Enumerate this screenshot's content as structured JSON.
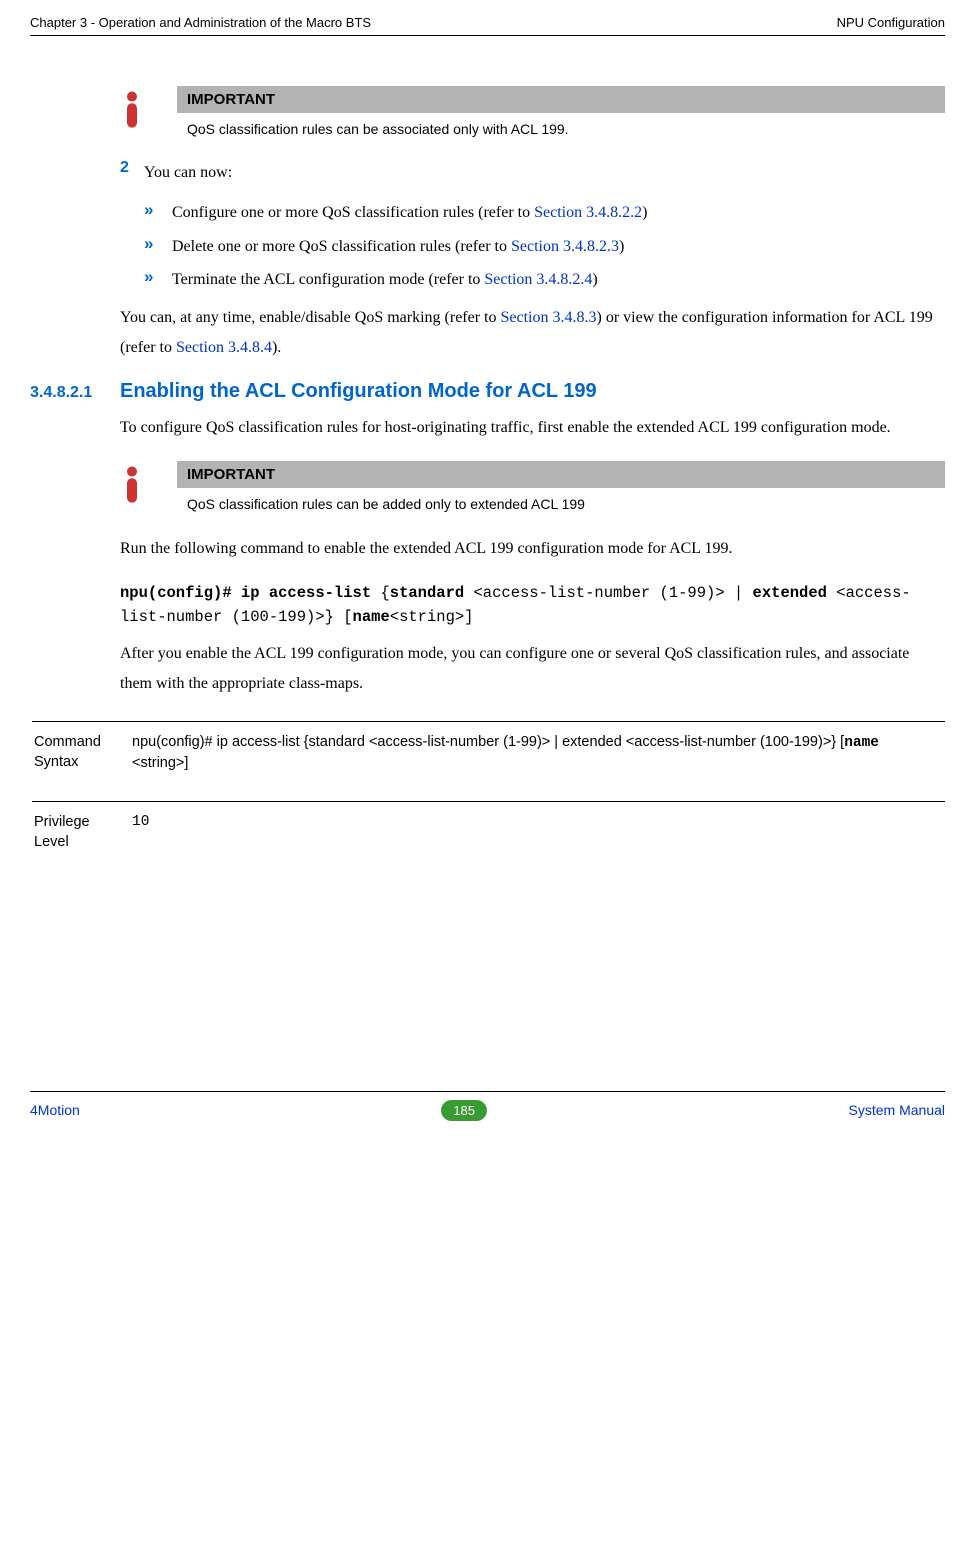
{
  "header": {
    "left": "Chapter 3 - Operation and Administration of the Macro BTS",
    "right": "NPU Configuration"
  },
  "callouts": {
    "title": "IMPORTANT",
    "c1": "QoS classification rules can be associated only with ACL 199.",
    "c2": "QoS classification rules can be added only to extended ACL 199"
  },
  "step": {
    "num": "2",
    "intro": "You can now:",
    "b1": {
      "text": "Configure one or more QoS classification rules (refer to ",
      "link": "Section 3.4.8.2.2",
      "after": ")"
    },
    "b2": {
      "text": "Delete one or more QoS classification rules (refer to ",
      "link": "Section 3.4.8.2.3",
      "after": ")"
    },
    "b3": {
      "text": "Terminate the ACL configuration mode (refer to ",
      "link": "Section 3.4.8.2.4",
      "after": ")"
    }
  },
  "para1": {
    "t1": "You can, at any time, enable/disable QoS marking (refer to ",
    "l1": "Section 3.4.8.3",
    "t2": ") or view the configuration information for ACL 199 (refer to ",
    "l2": "Section 3.4.8.4",
    "t3": ")."
  },
  "sec": {
    "num": "3.4.8.2.1",
    "title": "Enabling the ACL Configuration Mode for ACL 199"
  },
  "para2": "To configure QoS classification rules for host-originating traffic, first enable the extended ACL 199 configuration mode.",
  "para3": "Run the following command to enable the extended ACL 199 configuration mode for ACL 199.",
  "cmd": {
    "p1": "npu(config)# ip access-list",
    "p2": " {",
    "p3": "standard",
    "p4": " <access-list-number (1-99)> | ",
    "p5": "extended",
    "p6": " <access-list-number (100-199)>} [",
    "p7": "name",
    "p8": "<string>]"
  },
  "para4": "After you enable the ACL 199 configuration mode, you can configure one or several QoS classification rules, and associate them with the appropriate class-maps.",
  "table": {
    "r1_label": "Command Syntax",
    "r1_v_a": "npu(config)# ip access-list {standard <access-list-number (1-99)> | extended <access-list-number (100-199)>} [",
    "r1_v_b": "name",
    "r1_v_c": " <string>]",
    "r2_label": "Privilege Level",
    "r2_value": "10"
  },
  "footer": {
    "left": "4Motion",
    "page": "185",
    "right": "System Manual"
  }
}
